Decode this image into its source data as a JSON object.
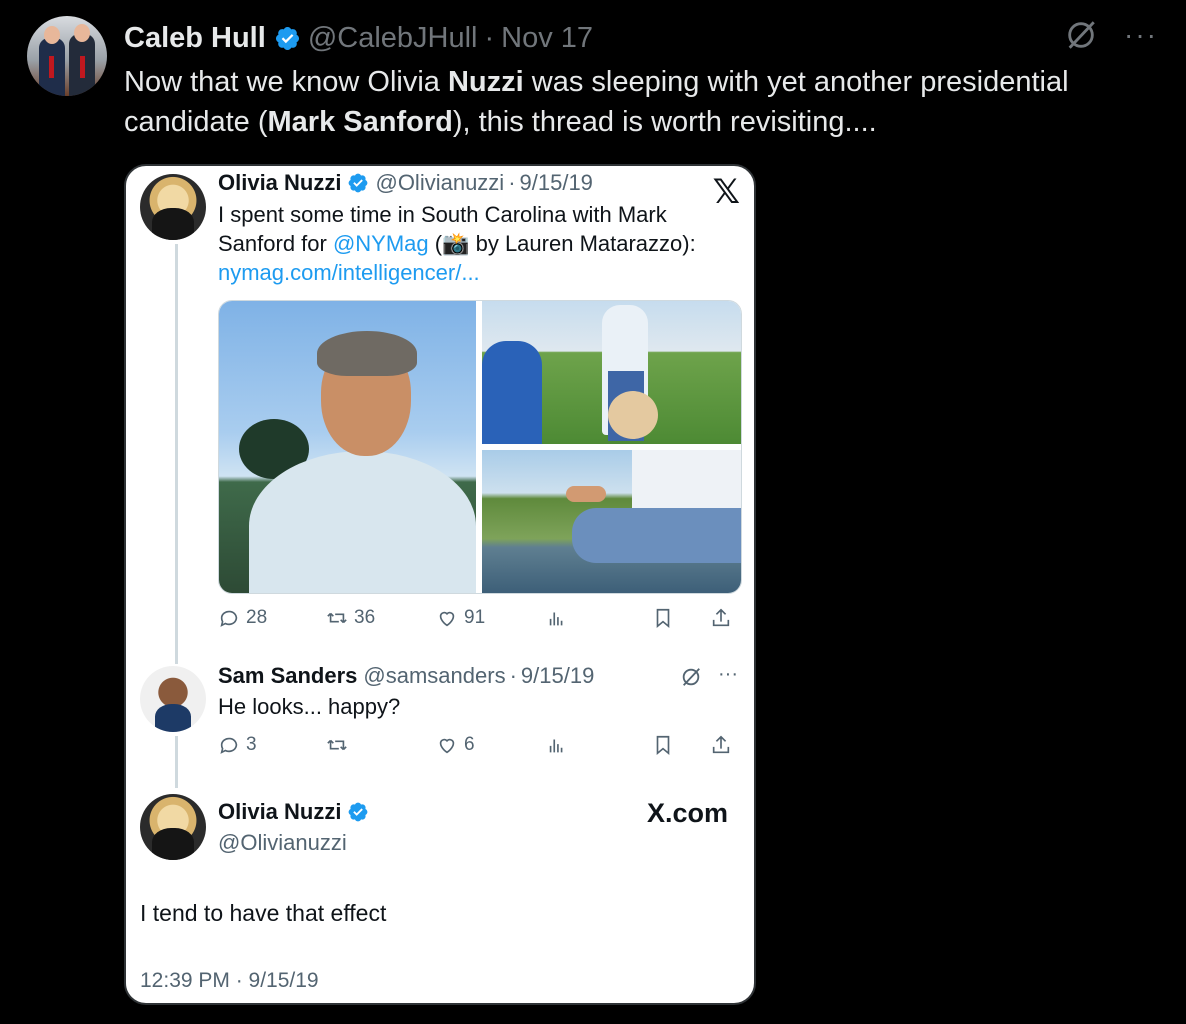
{
  "post": {
    "author_name": "Caleb Hull",
    "author_handle": "@CalebJHull",
    "separator": "·",
    "date": "Nov 17",
    "text_parts": [
      "Now that we know Olivia ",
      "Nuzzi",
      " was sleeping with yet another presidential candidate (",
      "Mark Sanford",
      "), this thread is worth revisiting...."
    ],
    "more_label": "···"
  },
  "quoted": {
    "tweet1": {
      "author_name": "Olivia Nuzzi",
      "author_handle": "@Olivianuzzi",
      "separator": "·",
      "date": "9/15/19",
      "text_line1": "I spent some time in South Carolina with Mark",
      "text_line2_pre": "Sanford for ",
      "mention": "@NYMag",
      "text_line2_post": " (📸 by Lauren Matarazzo):",
      "link": "nymag.com/intelligencer/...",
      "replies": "28",
      "retweets": "36",
      "likes": "91"
    },
    "tweet2": {
      "author_name": "Sam Sanders",
      "author_handle": "@samsanders",
      "separator": "·",
      "date": "9/15/19",
      "text": "He looks... happy?",
      "replies": "3",
      "retweets": "",
      "likes": "6",
      "more_label": "···"
    },
    "tweet3": {
      "author_name": "Olivia Nuzzi",
      "author_handle": "@Olivianuzzi",
      "text": "I tend to have that effect",
      "timestamp": "12:39 PM · 9/15/19",
      "brand": "X.com"
    },
    "x_logo": "𝕏"
  },
  "colors": {
    "background": "#000000",
    "text_primary": "#e7e9ea",
    "text_secondary": "#71767b",
    "verified_blue": "#1d9bf0",
    "card_bg": "#ffffff"
  },
  "icons": [
    "verified-badge-icon",
    "grok-icon",
    "more-icon",
    "x-logo-icon",
    "reply-icon",
    "retweet-icon",
    "like-icon",
    "views-icon",
    "bookmark-icon",
    "share-icon"
  ]
}
